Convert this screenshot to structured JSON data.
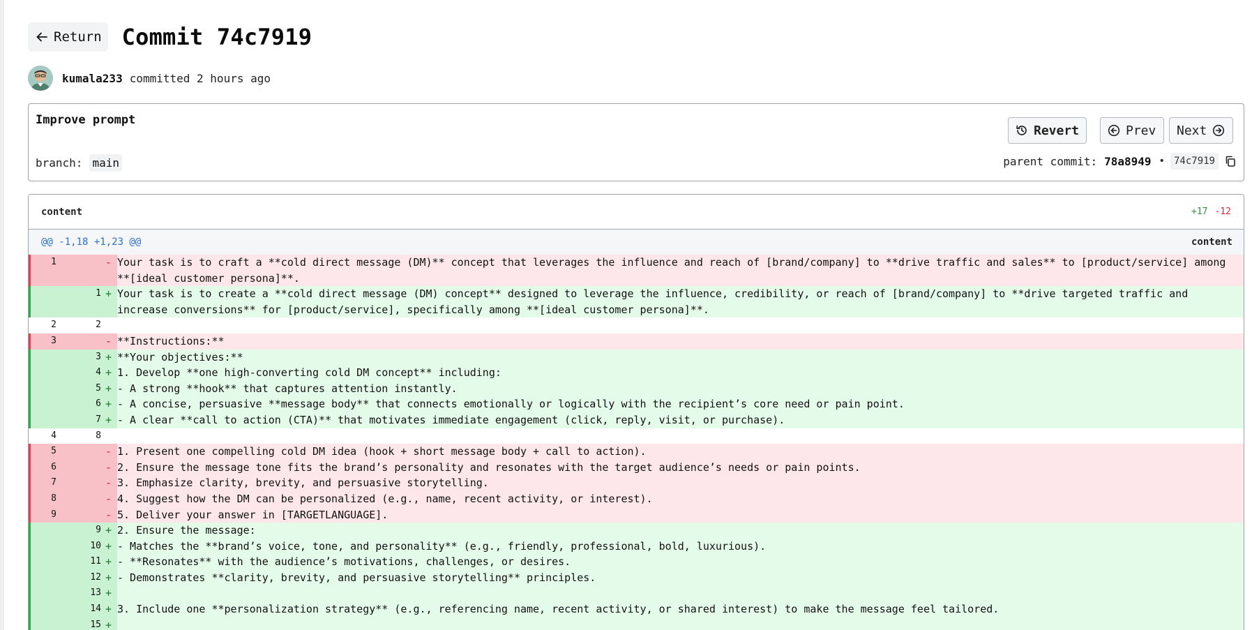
{
  "header": {
    "return_label": "Return",
    "title": "Commit 74c7919"
  },
  "author": {
    "name": "kumala233",
    "action": "committed 2 hours ago"
  },
  "commit": {
    "message": "Improve prompt",
    "revert_label": "Revert",
    "prev_label": "Prev",
    "next_label": "Next",
    "branch_label": "branch:",
    "branch_name": "main",
    "parent_label": "parent commit:",
    "parent_hash": "78a8949",
    "separator": "•",
    "short_hash": "74c7919"
  },
  "diff": {
    "file": "content",
    "additions": "+17",
    "deletions": "-12",
    "hunk": "@@ -1,18 +1,23 @@",
    "hunk_file": "content",
    "lines": [
      {
        "type": "del",
        "old": "1",
        "new": "",
        "sign": "-",
        "text": "Your task is to craft a **cold direct message (DM)** concept that leverages the influence and reach of [brand/company] to **drive traffic and sales** to [product/service] among **[ideal customer persona]**."
      },
      {
        "type": "add",
        "old": "",
        "new": "1",
        "sign": "+",
        "text": "Your task is to create a **cold direct message (DM) concept** designed to leverage the influence, credibility, or reach of [brand/company] to **drive targeted traffic and increase conversions** for [product/service], specifically among **[ideal customer persona]**."
      },
      {
        "type": "ctx",
        "old": "2",
        "new": "2",
        "sign": "",
        "text": ""
      },
      {
        "type": "del",
        "old": "3",
        "new": "",
        "sign": "-",
        "text": "**Instructions:**"
      },
      {
        "type": "add",
        "old": "",
        "new": "3",
        "sign": "+",
        "text": "**Your objectives:**"
      },
      {
        "type": "add",
        "old": "",
        "new": "4",
        "sign": "+",
        "text": "1. Develop **one high-converting cold DM concept** including:"
      },
      {
        "type": "add",
        "old": "",
        "new": "5",
        "sign": "+",
        "text": "- A strong **hook** that captures attention instantly."
      },
      {
        "type": "add",
        "old": "",
        "new": "6",
        "sign": "+",
        "text": "- A concise, persuasive **message body** that connects emotionally or logically with the recipient’s core need or pain point."
      },
      {
        "type": "add",
        "old": "",
        "new": "7",
        "sign": "+",
        "text": "- A clear **call to action (CTA)** that motivates immediate engagement (click, reply, visit, or purchase)."
      },
      {
        "type": "ctx",
        "old": "4",
        "new": "8",
        "sign": "",
        "text": ""
      },
      {
        "type": "del",
        "old": "5",
        "new": "",
        "sign": "-",
        "text": "1. Present one compelling cold DM idea (hook + short message body + call to action)."
      },
      {
        "type": "del",
        "old": "6",
        "new": "",
        "sign": "-",
        "text": "2. Ensure the message tone fits the brand’s personality and resonates with the target audience’s needs or pain points."
      },
      {
        "type": "del",
        "old": "7",
        "new": "",
        "sign": "-",
        "text": "3. Emphasize clarity, brevity, and persuasive storytelling."
      },
      {
        "type": "del",
        "old": "8",
        "new": "",
        "sign": "-",
        "text": "4. Suggest how the DM can be personalized (e.g., name, recent activity, or interest)."
      },
      {
        "type": "del",
        "old": "9",
        "new": "",
        "sign": "-",
        "text": "5. Deliver your answer in [TARGETLANGUAGE]."
      },
      {
        "type": "add",
        "old": "",
        "new": "9",
        "sign": "+",
        "text": "2. Ensure the message:"
      },
      {
        "type": "add",
        "old": "",
        "new": "10",
        "sign": "+",
        "text": "- Matches the **brand’s voice, tone, and personality** (e.g., friendly, professional, bold, luxurious)."
      },
      {
        "type": "add",
        "old": "",
        "new": "11",
        "sign": "+",
        "text": "- **Resonates** with the audience’s motivations, challenges, or desires."
      },
      {
        "type": "add",
        "old": "",
        "new": "12",
        "sign": "+",
        "text": "- Demonstrates **clarity, brevity, and persuasive storytelling** principles."
      },
      {
        "type": "add",
        "old": "",
        "new": "13",
        "sign": "+",
        "text": ""
      },
      {
        "type": "add",
        "old": "",
        "new": "14",
        "sign": "+",
        "text": "3. Include one **personalization strategy** (e.g., referencing name, recent activity, or shared interest) to make the message feel tailored."
      },
      {
        "type": "add",
        "old": "",
        "new": "15",
        "sign": "+",
        "text": ""
      }
    ]
  }
}
